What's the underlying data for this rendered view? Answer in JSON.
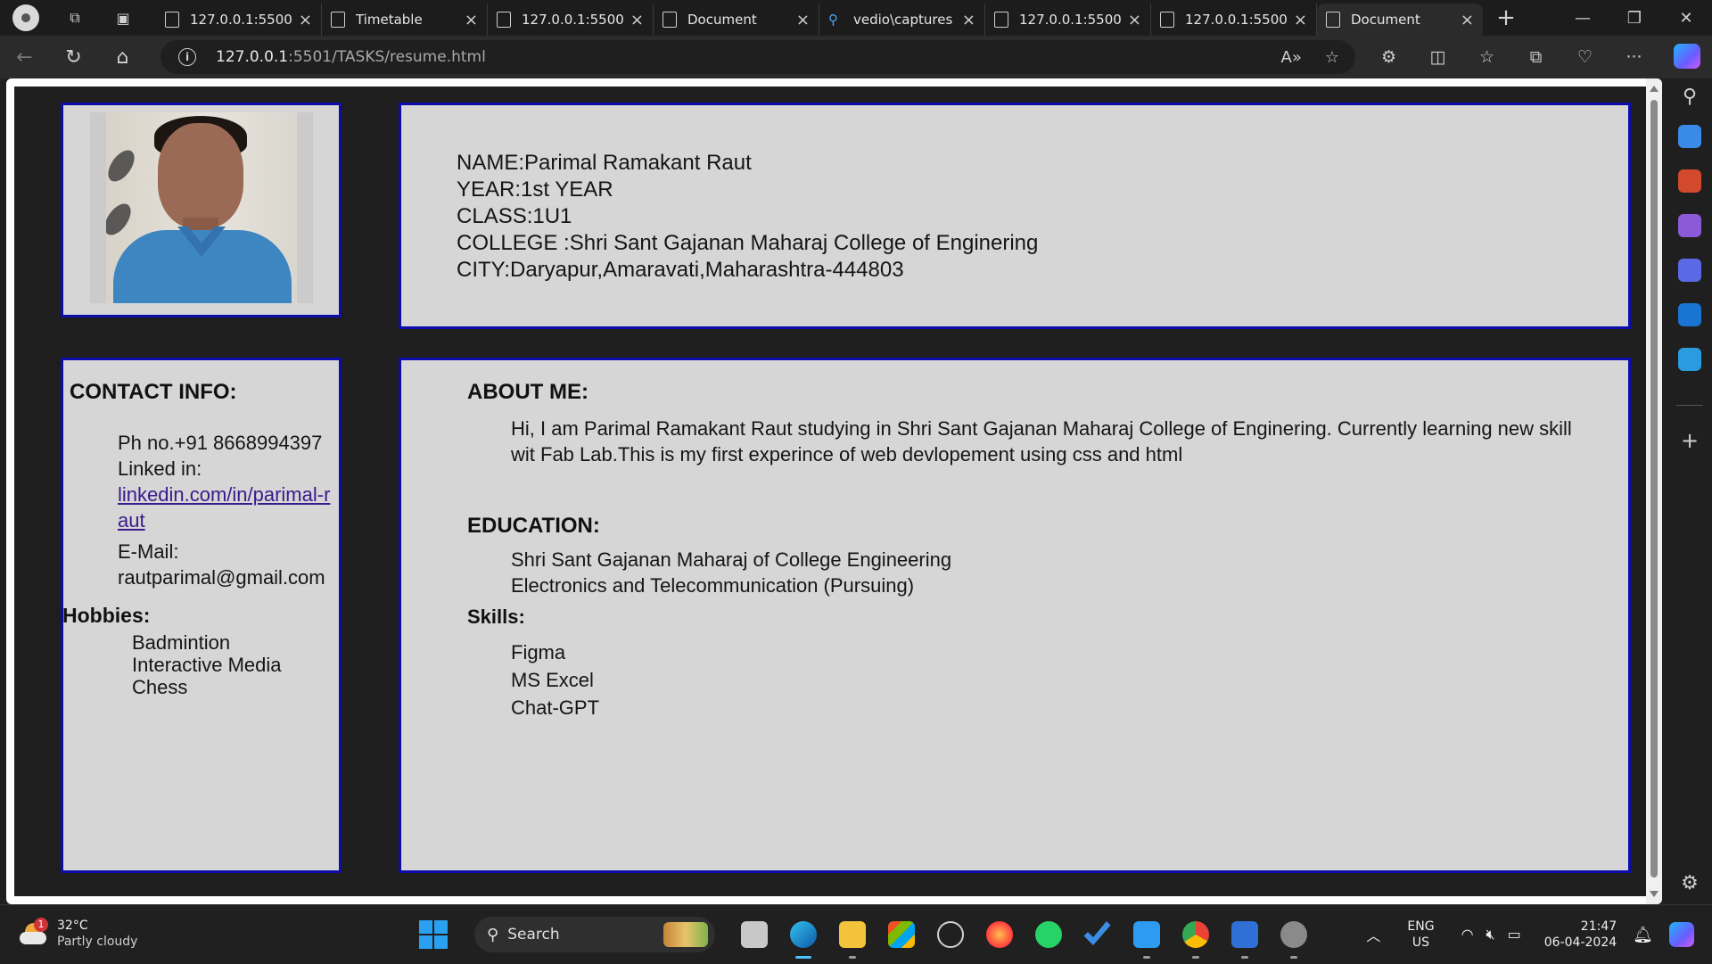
{
  "browser": {
    "tabs": [
      {
        "title": "127.0.0.1:5500/",
        "icon": "page-icon",
        "active": false
      },
      {
        "title": "Timetable",
        "icon": "page-icon",
        "active": false
      },
      {
        "title": "127.0.0.1:5500/",
        "icon": "page-icon",
        "active": false
      },
      {
        "title": "Document",
        "icon": "page-icon",
        "active": false
      },
      {
        "title": "vedio\\captures",
        "icon": "search-icon",
        "active": false
      },
      {
        "title": "127.0.0.1:5500/",
        "icon": "page-icon",
        "active": false
      },
      {
        "title": "127.0.0.1:5500/",
        "icon": "page-icon",
        "active": false
      },
      {
        "title": "Document",
        "icon": "page-icon",
        "active": true
      }
    ],
    "url_host": "127.0.0.1",
    "url_path": ":5501/TASKS/resume.html"
  },
  "profile": {
    "name_line": "NAME:Parimal Ramakant Raut",
    "year_line": "YEAR:1st YEAR",
    "class_line": "CLASS:1U1",
    "college_line": "COLLEGE :Shri Sant Gajanan Maharaj College of Enginering",
    "city_line": "CITY:Daryapur,Amaravati,Maharashtra-444803"
  },
  "contact": {
    "title": "CONTACT INFO:",
    "phone": "Ph no.+91 8668994397",
    "linkedin_label": "Linked in:",
    "linkedin_url": "linkedin.com/in/parimal-raut",
    "email_label": "E-Mail:",
    "email": "rautparimal@gmail.com"
  },
  "hobbies": {
    "title": "Hobbies:",
    "items": [
      "Badmintion",
      "Interactive Media",
      "Chess"
    ]
  },
  "about": {
    "title": "ABOUT ME:",
    "text": "Hi, I am Parimal Ramakant Raut studying in Shri Sant Gajanan Maharaj College of Enginering. Currently learning new skill wit Fab Lab.This is my first experince of web devlopement using css and html"
  },
  "education": {
    "title": "EDUCATION:",
    "college": "Shri Sant Gajanan Maharaj of College Engineering",
    "branch": "Electronics and Telecommunication (Pursuing)"
  },
  "skills": {
    "title": "Skills:",
    "items": [
      "Figma",
      "MS Excel",
      "Chat-GPT"
    ]
  },
  "taskbar": {
    "temp": "32°C",
    "weather": "Partly cloudy",
    "weather_badge": "1",
    "search_label": "Search",
    "lang_top": "ENG",
    "lang_bottom": "US",
    "time": "21:47",
    "date": "06-04-2024"
  },
  "colors": {
    "box_border": "#0c0cad",
    "box_fill": "#d6d6d6",
    "page_bg": "#1e1e1e",
    "link": "#3a1a8c"
  }
}
